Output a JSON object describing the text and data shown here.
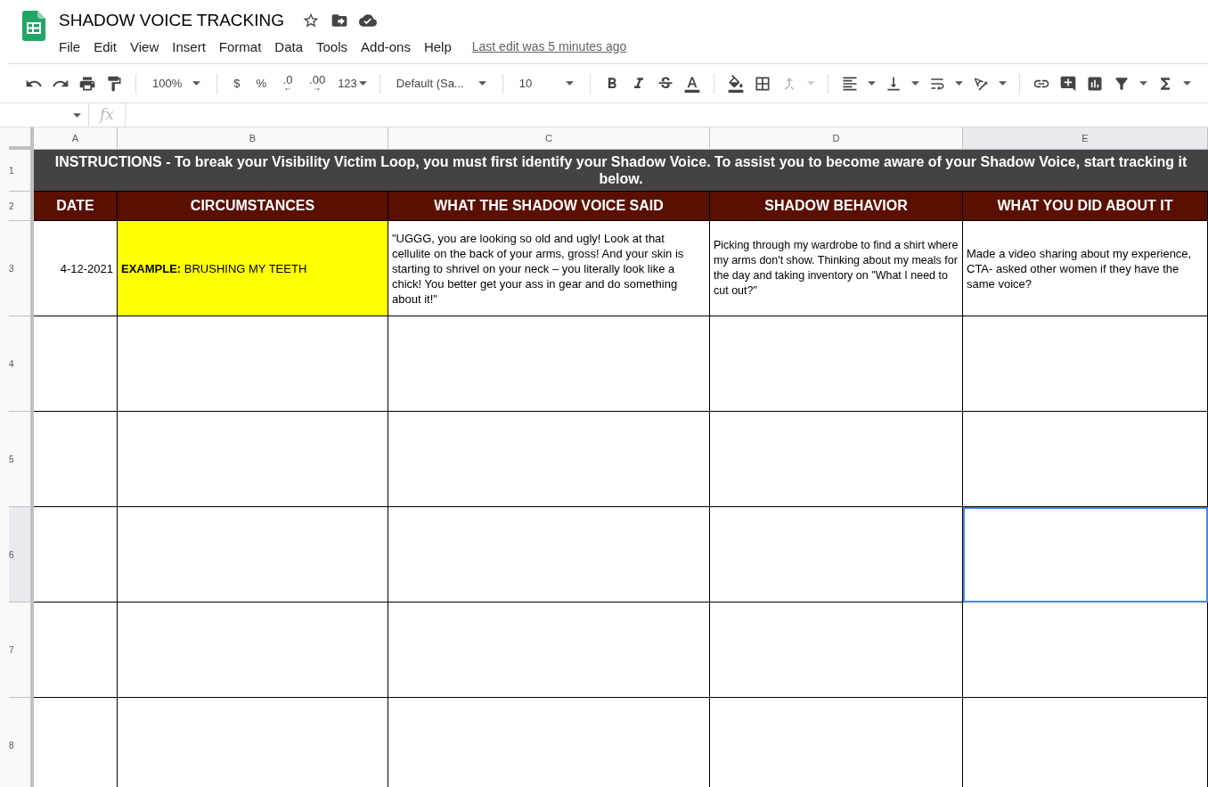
{
  "document": {
    "title": "SHADOW VOICE TRACKING",
    "last_edit": "Last edit was 5 minutes ago"
  },
  "menu": [
    "File",
    "Edit",
    "View",
    "Insert",
    "Format",
    "Data",
    "Tools",
    "Add-ons",
    "Help"
  ],
  "toolbar": {
    "zoom": "100%",
    "currency": "$",
    "percent": "%",
    "decrease_decimals": ".0",
    "increase_decimals": ".00",
    "number_format": "123",
    "font": "Default (Sa...",
    "font_size": "10"
  },
  "formula_bar": {
    "function_label": "fx"
  },
  "columns": [
    {
      "label": "A",
      "selected": false
    },
    {
      "label": "B",
      "selected": false
    },
    {
      "label": "C",
      "selected": false
    },
    {
      "label": "D",
      "selected": false
    },
    {
      "label": "E",
      "selected": true
    }
  ],
  "rows": [
    {
      "label": "1",
      "selected": false
    },
    {
      "label": "2",
      "selected": false
    },
    {
      "label": "3",
      "selected": false
    },
    {
      "label": "4",
      "selected": false
    },
    {
      "label": "5",
      "selected": false
    },
    {
      "label": "6",
      "selected": true
    },
    {
      "label": "7",
      "selected": false
    },
    {
      "label": "8",
      "selected": false
    }
  ],
  "instructions": "INSTRUCTIONS - To break your Visibility Victim Loop, you must first identify your Shadow Voice. To assist you to become aware of your Shadow Voice, start tracking it below.",
  "headings": [
    "DATE",
    "CIRCUMSTANCES",
    "WHAT THE SHADOW VOICE SAID",
    "SHADOW BEHAVIOR",
    "WHAT YOU DID ABOUT IT"
  ],
  "example": {
    "date": "4-12-2021",
    "circumstances": "**EXAMPLE:** BRUSHING MY TEETH",
    "shadow_voice": "\"UGGG, you are looking so old and ugly! Look at that cellulite on the back of your arms, gross! And your skin is starting to shrivel on your neck – you literally look like a chick! You better get your ass in gear and do something about it!\"",
    "behavior": "Picking through my wardrobe to find a shirt where my arms don't show. Thinking about my meals for the day and taking inventory on \"What I need to cut out?\"",
    "action": "Made a video sharing about my experience, CTA- asked other women if they have the same voice?"
  }
}
